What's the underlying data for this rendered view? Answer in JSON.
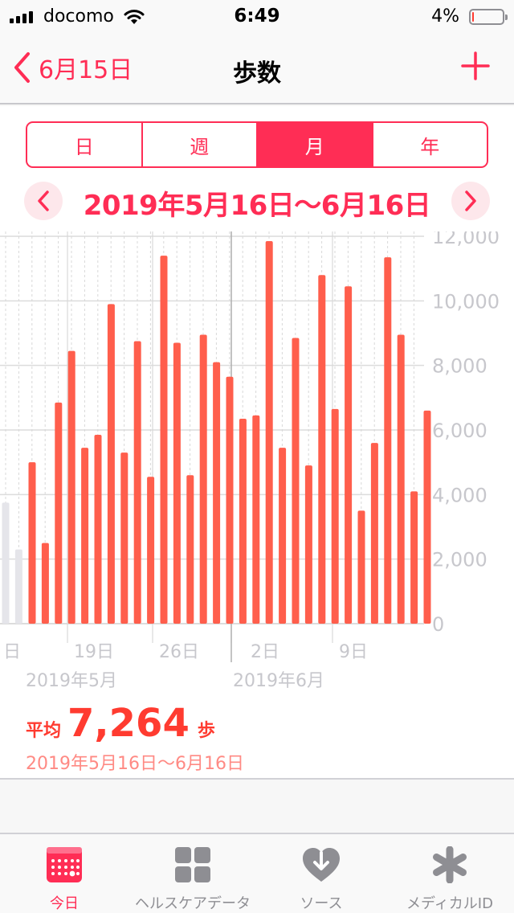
{
  "status_bar": {
    "carrier": "docomo",
    "time": "6:49",
    "battery_percent": "4%",
    "battery_level": 0.04
  },
  "nav": {
    "back_label": "6月15日",
    "title": "歩数"
  },
  "segments": [
    {
      "label": "日",
      "active": false
    },
    {
      "label": "週",
      "active": false
    },
    {
      "label": "月",
      "active": true
    },
    {
      "label": "年",
      "active": false
    }
  ],
  "range_label": "2019年5月16日〜6月16日",
  "chart_data": {
    "type": "bar",
    "ylim": [
      0,
      12000
    ],
    "y_ticks": [
      "12,000",
      "10,000",
      "8,000",
      "6,000",
      "4,000",
      "2,000",
      "0"
    ],
    "x_tick_labels": [
      "日",
      "19日",
      "26日",
      "2日",
      "9日"
    ],
    "month_labels": [
      "2019年5月",
      "2019年6月"
    ],
    "grid": true,
    "colors": {
      "bar": "#ff5e4c",
      "bar_out_of_range": "#e5e5ea",
      "grid": "#dcdcdc",
      "axis_text": "#c7c7cc"
    },
    "out_of_range_values": [
      3750,
      2300
    ],
    "values": [
      5000,
      2500,
      6850,
      8450,
      5450,
      5850,
      9900,
      5300,
      8750,
      4550,
      11400,
      8700,
      4600,
      8950,
      8100,
      7650,
      6350,
      6450,
      11850,
      5450,
      8850,
      4900,
      10800,
      6650,
      10450,
      3500,
      5600,
      11350,
      8950,
      4100,
      6600
    ]
  },
  "summary": {
    "avg_label": "平均",
    "avg_value": "7,264",
    "avg_unit": "歩",
    "range": "2019年5月16日〜6月16日"
  },
  "tabs": [
    {
      "label": "今日",
      "icon": "calendar-today-icon",
      "active": true
    },
    {
      "label": "ヘルスケアデータ",
      "icon": "grid-icon",
      "active": false
    },
    {
      "label": "ソース",
      "icon": "heart-download-icon",
      "active": false
    },
    {
      "label": "メディカルID",
      "icon": "asterisk-icon",
      "active": false
    }
  ],
  "accent_color": "#ff2d55"
}
